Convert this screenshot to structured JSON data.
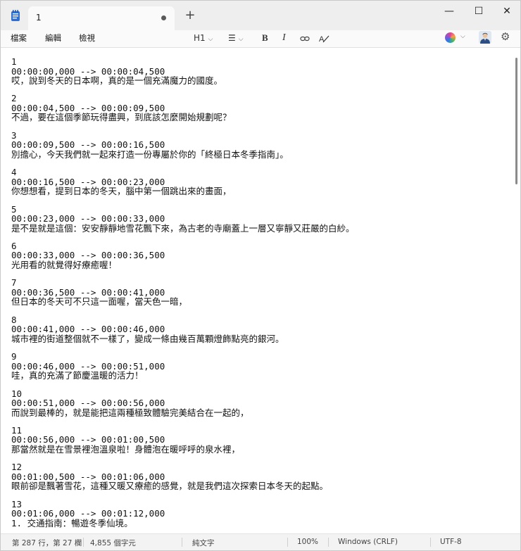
{
  "tab": {
    "title": "1",
    "unsaved_indicator": "dot-icon"
  },
  "new_tab_label": "+",
  "window_controls": {
    "minimize": "—",
    "maximize": "☐",
    "close": "✕"
  },
  "menu": {
    "file": "檔案",
    "edit": "編輯",
    "view": "檢視"
  },
  "format": {
    "heading": "H1",
    "list": "☰",
    "bold": "B",
    "italic": "I",
    "link": "⛓",
    "clear": "A̶"
  },
  "settings_icon": "⚙",
  "subtitles": [
    {
      "index": "1",
      "time": "00:00:00,000 --> 00:00:04,500",
      "text": "哎，說到冬天的日本啊，真的是一個充滿魔力的國度。"
    },
    {
      "index": "2",
      "time": "00:00:04,500 --> 00:00:09,500",
      "text": "不過，要在這個季節玩得盡興，到底該怎麼開始規劃呢？"
    },
    {
      "index": "3",
      "time": "00:00:09,500 --> 00:00:16,500",
      "text": "別擔心，今天我們就一起來打造一份專屬於你的「終極日本冬季指南」。"
    },
    {
      "index": "4",
      "time": "00:00:16,500 --> 00:00:23,000",
      "text": "你想想看，提到日本的冬天，腦中第一個跳出來的畫面，"
    },
    {
      "index": "5",
      "time": "00:00:23,000 --> 00:00:33,000",
      "text": "是不是就是這個：安安靜靜地雪花飄下來，為古老的寺廟蓋上一層又寧靜又莊嚴的白紗。"
    },
    {
      "index": "6",
      "time": "00:00:33,000 --> 00:00:36,500",
      "text": "光用看的就覺得好療癒喔！"
    },
    {
      "index": "7",
      "time": "00:00:36,500 --> 00:00:41,000",
      "text": "但日本的冬天可不只這一面喔，當天色一暗，"
    },
    {
      "index": "8",
      "time": "00:00:41,000 --> 00:00:46,000",
      "text": "城市裡的街道整個就不一樣了，變成一條由幾百萬顆燈飾點亮的銀河。"
    },
    {
      "index": "9",
      "time": "00:00:46,000 --> 00:00:51,000",
      "text": "哇，真的充滿了節慶溫暖的活力！"
    },
    {
      "index": "10",
      "time": "00:00:51,000 --> 00:00:56,000",
      "text": "而說到最棒的，就是能把這兩種極致體驗完美結合在一起的，"
    },
    {
      "index": "11",
      "time": "00:00:56,000 --> 00:01:00,500",
      "text": "那當然就是在雪景裡泡溫泉啦！身體泡在暖呼呼的泉水裡，"
    },
    {
      "index": "12",
      "time": "00:01:00,500 --> 00:01:06,000",
      "text": "眼前卻是飄著雪花，這種又暖又療癒的感覺，就是我們這次探索日本冬天的起點。"
    },
    {
      "index": "13",
      "time": "00:01:06,000 --> 00:01:12,000",
      "text": "1. 交通指南：暢遊冬季仙境。"
    }
  ],
  "status": {
    "position": "第 287 行，第 27 欄",
    "chars": "4,855 個字元",
    "format": "純文字",
    "zoom": "100%",
    "line_ending": "Windows (CRLF)",
    "encoding": "UTF-8"
  }
}
